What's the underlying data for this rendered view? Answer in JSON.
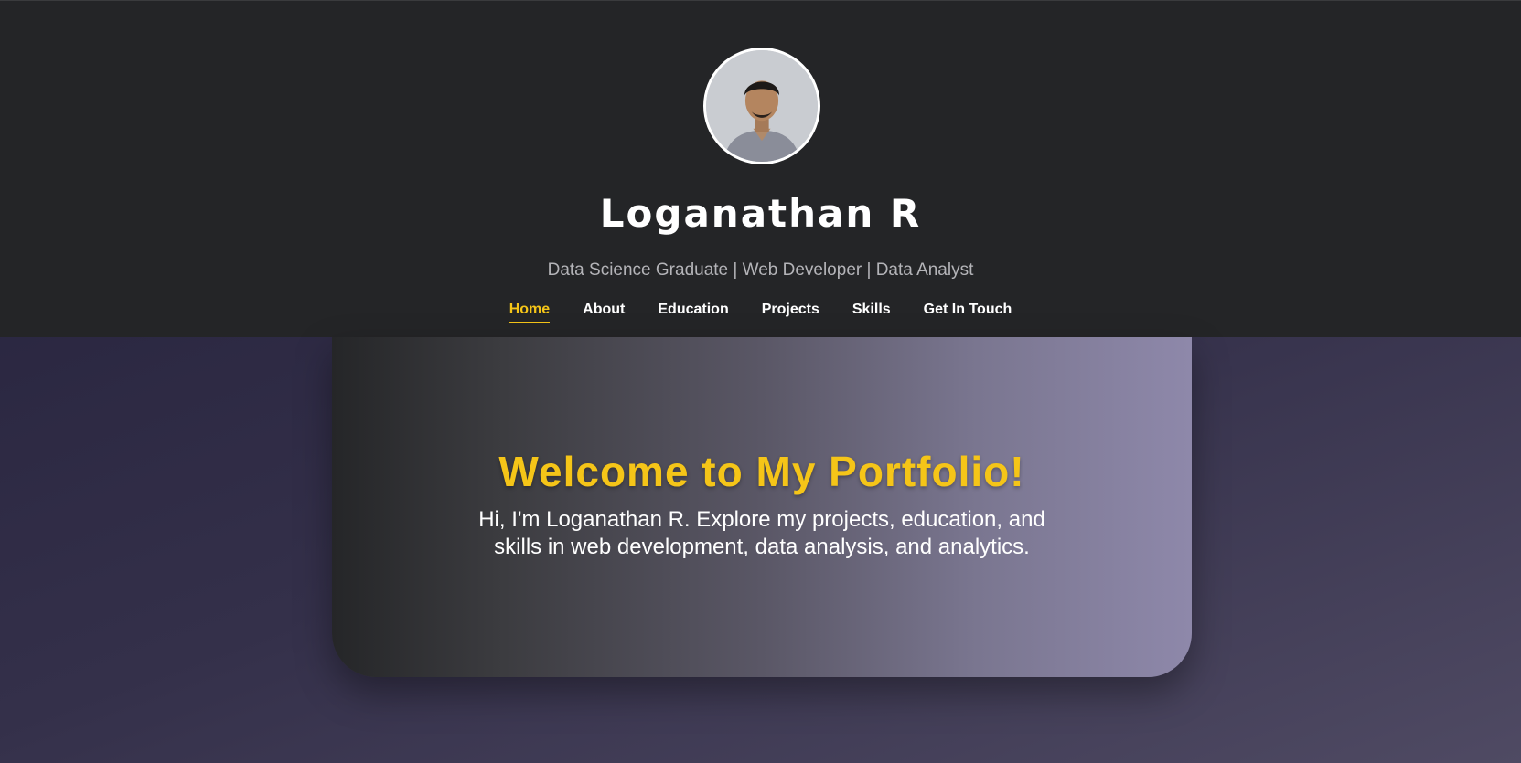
{
  "header": {
    "name": "Loganathan R",
    "tagline": "Data Science Graduate | Web Developer | Data Analyst",
    "avatar_alt": "profile-photo"
  },
  "nav": {
    "items": [
      {
        "label": "Home",
        "active": true
      },
      {
        "label": "About",
        "active": false
      },
      {
        "label": "Education",
        "active": false
      },
      {
        "label": "Projects",
        "active": false
      },
      {
        "label": "Skills",
        "active": false
      },
      {
        "label": "Get In Touch",
        "active": false
      }
    ]
  },
  "hero": {
    "title": "Welcome to My Portfolio!",
    "text": "Hi, I'm Loganathan R. Explore my projects, education, and skills in web development, data analysis, and analytics."
  },
  "colors": {
    "accent": "#f5c518",
    "header_bg": "#242527"
  }
}
